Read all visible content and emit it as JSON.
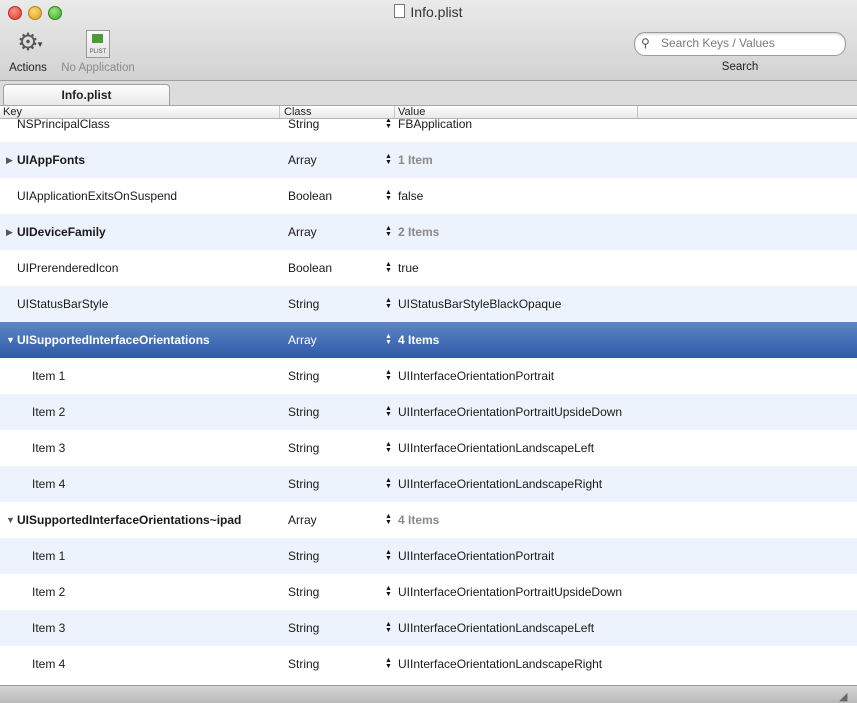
{
  "window": {
    "title": "Info.plist"
  },
  "toolbar": {
    "actions_label": "Actions",
    "no_app_label": "No Application",
    "plist_icon_text": "PLIST",
    "search_placeholder": "Search Keys / Values",
    "search_label": "Search"
  },
  "tab": {
    "label": "Info.plist"
  },
  "columns": {
    "key": "Key",
    "class": "Class",
    "value": "Value"
  },
  "rows": [
    {
      "key": "NSPrincipalClass",
      "class": "String",
      "value": "FBApplication"
    },
    {
      "key": "UIAppFonts",
      "class": "Array",
      "value": "1 Item"
    },
    {
      "key": "UIApplicationExitsOnSuspend",
      "class": "Boolean",
      "value": "false"
    },
    {
      "key": "UIDeviceFamily",
      "class": "Array",
      "value": "2 Items"
    },
    {
      "key": "UIPrerenderedIcon",
      "class": "Boolean",
      "value": "true"
    },
    {
      "key": "UIStatusBarStyle",
      "class": "String",
      "value": "UIStatusBarStyleBlackOpaque"
    },
    {
      "key": "UISupportedInterfaceOrientations",
      "class": "Array",
      "value": "4 Items"
    },
    {
      "key": "Item 1",
      "class": "String",
      "value": "UIInterfaceOrientationPortrait"
    },
    {
      "key": "Item 2",
      "class": "String",
      "value": "UIInterfaceOrientationPortraitUpsideDown"
    },
    {
      "key": "Item 3",
      "class": "String",
      "value": "UIInterfaceOrientationLandscapeLeft"
    },
    {
      "key": "Item 4",
      "class": "String",
      "value": "UIInterfaceOrientationLandscapeRight"
    },
    {
      "key": "UISupportedInterfaceOrientations~ipad",
      "class": "Array",
      "value": "4 Items"
    },
    {
      "key": "Item 1",
      "class": "String",
      "value": "UIInterfaceOrientationPortrait"
    },
    {
      "key": "Item 2",
      "class": "String",
      "value": "UIInterfaceOrientationPortraitUpsideDown"
    },
    {
      "key": "Item 3",
      "class": "String",
      "value": "UIInterfaceOrientationLandscapeLeft"
    },
    {
      "key": "Item 4",
      "class": "String",
      "value": "UIInterfaceOrientationLandscapeRight"
    }
  ],
  "colors": {
    "selection": "#3a63ad",
    "alt_row": "#edf3fc"
  }
}
